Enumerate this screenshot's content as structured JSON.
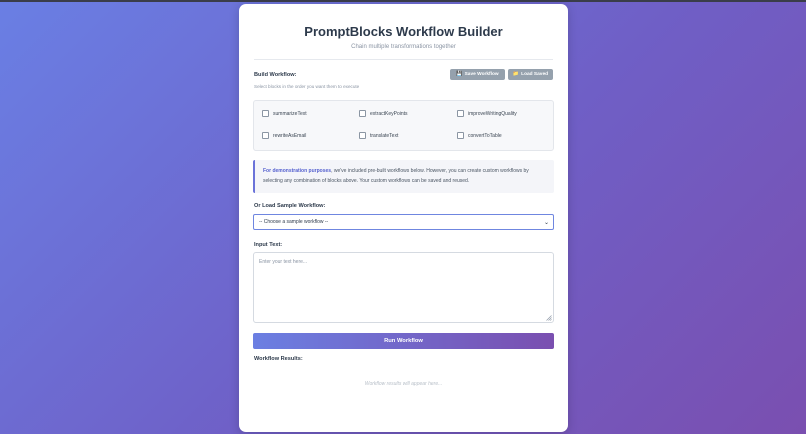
{
  "app": {
    "title": "PromptBlocks Workflow Builder",
    "subtitle": "Chain multiple transformations together"
  },
  "build": {
    "label": "Build Workflow:",
    "hint": "Select blocks in the order you want them to execute",
    "save_label": "Save Workflow",
    "save_icon": "floppy-disk-icon",
    "load_label": "Load Saved",
    "load_icon": "folder-icon",
    "blocks": [
      {
        "label": "summarizeText",
        "checked": false
      },
      {
        "label": "extractKeyPoints",
        "checked": false
      },
      {
        "label": "improveWritingQuality",
        "checked": false
      },
      {
        "label": "rewriteAsEmail",
        "checked": false
      },
      {
        "label": "translateText",
        "checked": false
      },
      {
        "label": "convertToTable",
        "checked": false
      }
    ]
  },
  "note": {
    "emphasis": "For demonstration purposes",
    "text": ", we've included pre-built workflows below. However, you can create custom workflows by selecting any combination of blocks above. Your custom workflows can be saved and reused."
  },
  "sample": {
    "label": "Or Load Sample Workflow:",
    "selected": "-- Choose a sample workflow --"
  },
  "input": {
    "label": "Input Text:",
    "placeholder": "Enter your text here..."
  },
  "run": {
    "label": "Run Workflow"
  },
  "results": {
    "label": "Workflow Results:",
    "placeholder": "Workflow results will appear here..."
  },
  "colors": {
    "accent": "#6f86e0",
    "button_gray": "#95a1ad",
    "gradient_start": "#6b7fe2",
    "gradient_end": "#7a4fb0"
  }
}
